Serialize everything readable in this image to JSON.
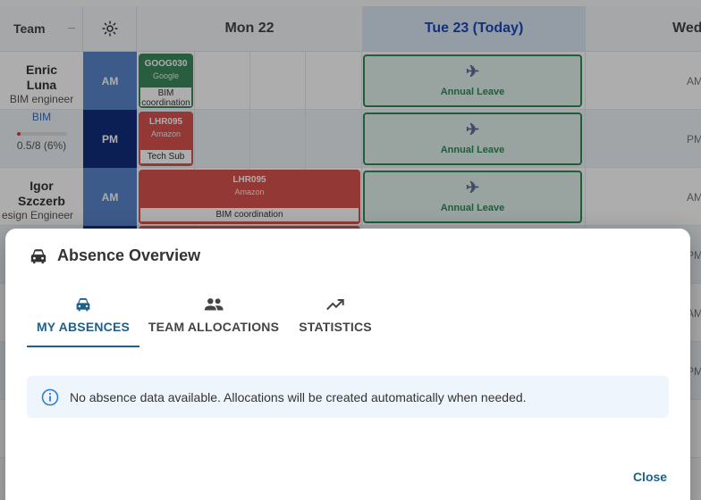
{
  "scheduler": {
    "header": {
      "team_label": "Team",
      "days": [
        "Mon 22",
        "Tue 23 (Today)",
        "Wed"
      ]
    },
    "members": [
      {
        "name_line1": "Enric",
        "name_line2": "Luna",
        "role": "BIM engineer",
        "tag": "BIM",
        "capacity": "0.5/8 (6%)",
        "utilization_pct": 6
      },
      {
        "name_line1": "Igor",
        "name_line2": "Szczerb",
        "role": "esign Engineer"
      }
    ],
    "slots": [
      "AM",
      "PM",
      "AM"
    ],
    "cards": [
      {
        "code": "GOOG030",
        "client": "Google",
        "task": "BIM coordination",
        "color": "#3d8a5e"
      },
      {
        "code": "LHR095",
        "client": "Amazon",
        "task": "Tech Sub",
        "color": "#d9534f"
      },
      {
        "code": "LHR095",
        "client": "Amazon",
        "task": "BIM coordination",
        "color": "#d9534f"
      }
    ],
    "leave_label": "Annual Leave",
    "wed_slots": [
      "AM",
      "PM",
      "AM",
      "PM",
      "AM",
      "PM"
    ]
  },
  "dialog": {
    "title": "Absence Overview",
    "title_icon": "car-icon",
    "tabs": [
      {
        "label": "MY ABSENCES",
        "icon": "car-icon",
        "active": true
      },
      {
        "label": "TEAM ALLOCATIONS",
        "icon": "people-icon",
        "active": false
      },
      {
        "label": "STATISTICS",
        "icon": "trending-up-icon",
        "active": false
      }
    ],
    "info_message": "No absence data available. Allocations will be created automatically when needed.",
    "close_label": "Close",
    "colors": {
      "primary": "#1f5f8b",
      "info_bg": "#eef5fc",
      "info_icon": "#2c7fd1"
    }
  }
}
